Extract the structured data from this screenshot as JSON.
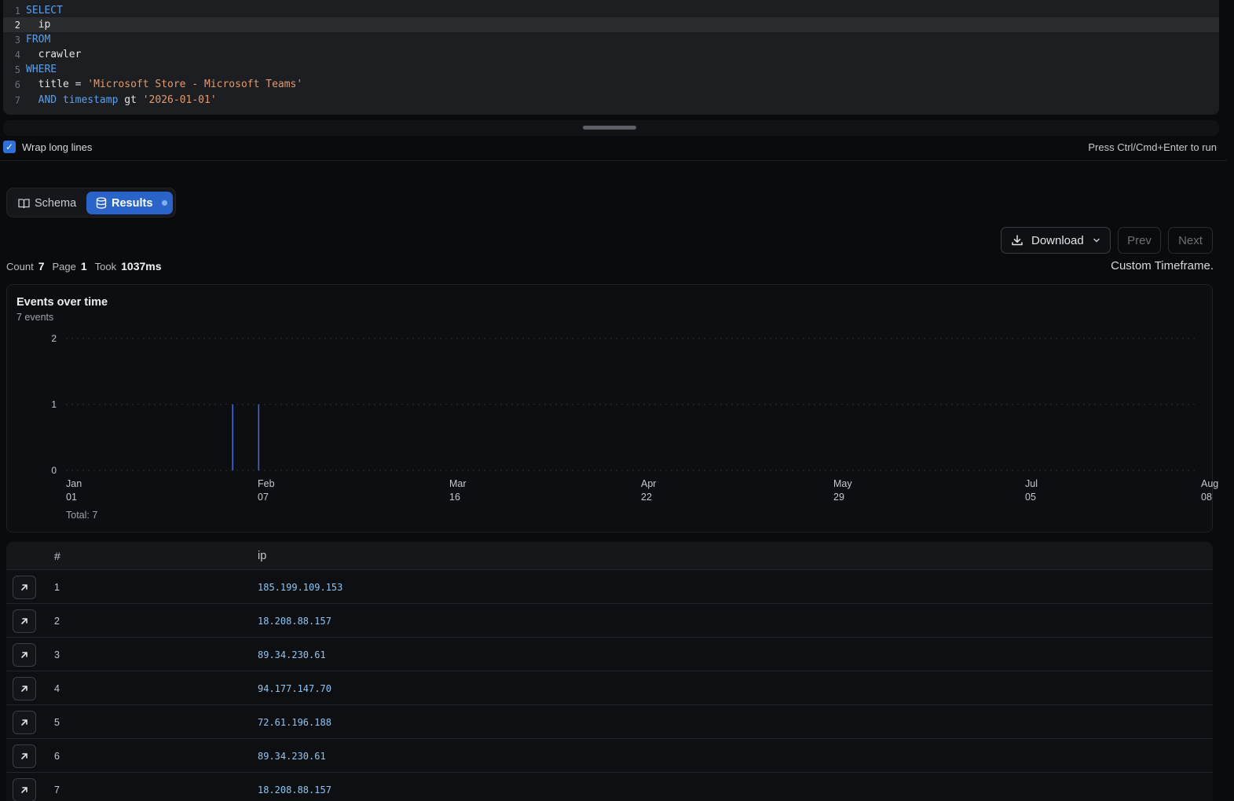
{
  "editor": {
    "lines": [
      {
        "n": "1",
        "tokens": [
          {
            "t": "SELECT",
            "c": "kw"
          }
        ]
      },
      {
        "n": "2",
        "tokens": [
          {
            "t": "  ip",
            "c": "id"
          }
        ]
      },
      {
        "n": "3",
        "tokens": [
          {
            "t": "FROM",
            "c": "kw"
          }
        ]
      },
      {
        "n": "4",
        "tokens": [
          {
            "t": "  crawler",
            "c": "id"
          }
        ]
      },
      {
        "n": "5",
        "tokens": [
          {
            "t": "WHERE",
            "c": "kw"
          }
        ]
      },
      {
        "n": "6",
        "tokens": [
          {
            "t": "  title",
            "c": "id"
          },
          {
            "t": " = ",
            "c": "op"
          },
          {
            "t": "'Microsoft Store - Microsoft Teams'",
            "c": "str"
          }
        ]
      },
      {
        "n": "7",
        "tokens": [
          {
            "t": "  AND",
            "c": "kw"
          },
          {
            "t": " timestamp",
            "c": "kw"
          },
          {
            "t": " gt ",
            "c": "id"
          },
          {
            "t": "'2026-01-01'",
            "c": "str"
          }
        ]
      }
    ],
    "active_line": "2",
    "wrap_label": "Wrap long lines",
    "run_hint": "Press Ctrl/Cmd+Enter to run"
  },
  "tabs": {
    "schema_label": "Schema",
    "results_label": "Results"
  },
  "toolbar": {
    "download_label": "Download",
    "prev_label": "Prev",
    "next_label": "Next",
    "timeframe": "Custom Timeframe."
  },
  "stats": {
    "count_label": "Count",
    "count_value": "7",
    "page_label": "Page",
    "page_value": "1",
    "took_label": "Took",
    "took_value": "1037ms"
  },
  "chart_data": {
    "type": "bar",
    "title": "Events over time",
    "subtitle": "7 events",
    "total_label": "Total: 7",
    "ylim": [
      0,
      2
    ],
    "yticks": [
      "2",
      "1",
      "0"
    ],
    "xticks": [
      {
        "month": "Jan",
        "day": "01"
      },
      {
        "month": "Feb",
        "day": "07"
      },
      {
        "month": "Mar",
        "day": "16"
      },
      {
        "month": "Apr",
        "day": "22"
      },
      {
        "month": "May",
        "day": "29"
      },
      {
        "month": "Jul",
        "day": "05"
      },
      {
        "month": "Aug",
        "day": "08"
      }
    ],
    "x_start": "2026-01-01",
    "x_end": "2026-08-08",
    "bars": [
      {
        "date": "2026-02-02",
        "value": 1
      },
      {
        "date": "2026-02-07",
        "value": 1
      }
    ],
    "grid": true,
    "color": "#3a6fe0"
  },
  "table": {
    "columns": [
      "#",
      "ip"
    ],
    "rows": [
      {
        "num": "1",
        "ip": "185.199.109.153"
      },
      {
        "num": "2",
        "ip": "18.208.88.157"
      },
      {
        "num": "3",
        "ip": "89.34.230.61"
      },
      {
        "num": "4",
        "ip": "94.177.147.70"
      },
      {
        "num": "5",
        "ip": "72.61.196.188"
      },
      {
        "num": "6",
        "ip": "89.34.230.61"
      },
      {
        "num": "7",
        "ip": "18.208.88.157"
      }
    ]
  }
}
